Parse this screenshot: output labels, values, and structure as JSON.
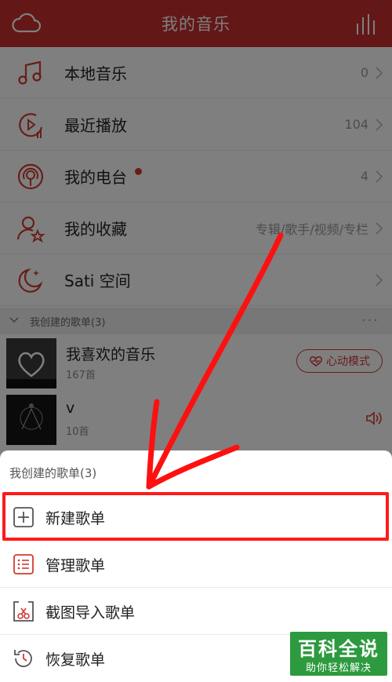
{
  "header": {
    "title": "我的音乐"
  },
  "menu": [
    {
      "label": "本地音乐",
      "count": "0"
    },
    {
      "label": "最近播放",
      "count": "104"
    },
    {
      "label": "我的电台",
      "count": "4"
    },
    {
      "label": "我的收藏",
      "count": "专辑/歌手/视频/专栏"
    },
    {
      "label": "Sati 空间",
      "count": ""
    }
  ],
  "section": {
    "label": "我创建的歌单(3)",
    "more": "···"
  },
  "playlists": [
    {
      "name": "我喜欢的音乐",
      "count": "167首",
      "button": "心动模式"
    },
    {
      "name": "v",
      "count": "10首"
    }
  ],
  "sheet": {
    "title": "我创建的歌单(3)",
    "items": [
      {
        "label": "新建歌单",
        "icon": "plus-icon"
      },
      {
        "label": "管理歌单",
        "icon": "list-icon"
      },
      {
        "label": "截图导入歌单",
        "icon": "screenshot-import-icon"
      },
      {
        "label": "恢复歌单",
        "icon": "restore-clock-icon"
      }
    ]
  },
  "watermark": {
    "big": "百科全说",
    "small": "助你轻松解决"
  },
  "colors": {
    "brand": "#c62f2f",
    "highlight": "#ff1a1a",
    "watermark": "#2d9a3f"
  }
}
